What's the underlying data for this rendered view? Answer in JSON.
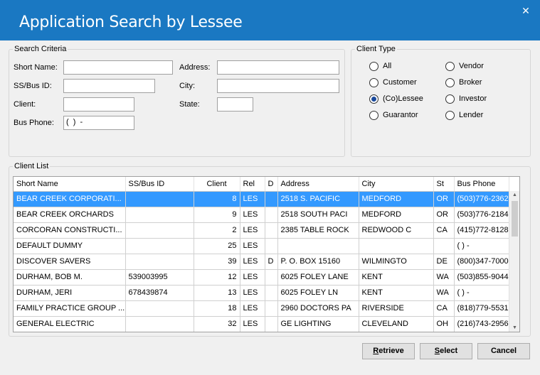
{
  "window": {
    "title": "Application Search by Lessee",
    "close_glyph": "✕"
  },
  "search_criteria": {
    "legend": "Search Criteria",
    "short_name_label": "Short Name:",
    "short_name_value": "",
    "ss_bus_id_label": "SS/Bus ID:",
    "ss_bus_id_value": "",
    "client_label": "Client:",
    "client_value": "",
    "bus_phone_label": "Bus Phone:",
    "bus_phone_value": "(  )  -",
    "address_label": "Address:",
    "address_value": "",
    "city_label": "City:",
    "city_value": "",
    "state_label": "State:",
    "state_value": ""
  },
  "client_type": {
    "legend": "Client Type",
    "options": [
      {
        "label": "All",
        "selected": false
      },
      {
        "label": "Customer",
        "selected": false
      },
      {
        "label": "(Co)Lessee",
        "selected": true
      },
      {
        "label": "Guarantor",
        "selected": false
      },
      {
        "label": "Vendor",
        "selected": false
      },
      {
        "label": "Broker",
        "selected": false
      },
      {
        "label": "Investor",
        "selected": false
      },
      {
        "label": "Lender",
        "selected": false
      }
    ]
  },
  "client_list": {
    "legend": "Client List",
    "columns": [
      "Short Name",
      "SS/Bus ID",
      "Client",
      "Rel",
      "D",
      "Address",
      "City",
      "St",
      "Bus Phone"
    ],
    "rows": [
      [
        "BEAR CREEK CORPORATI...",
        "",
        "8",
        "LES",
        "",
        "2518 S. PACIFIC",
        "MEDFORD",
        "OR",
        "(503)776-2362"
      ],
      [
        "BEAR CREEK ORCHARDS",
        "",
        "9",
        "LES",
        "",
        "2518 SOUTH PACI",
        "MEDFORD",
        "OR",
        "(503)776-2184"
      ],
      [
        "CORCORAN CONSTRUCTI...",
        "",
        "2",
        "LES",
        "",
        "2385 TABLE ROCK",
        "REDWOOD C",
        "CA",
        "(415)772-8128"
      ],
      [
        "DEFAULT DUMMY",
        "",
        "25",
        "LES",
        "",
        "",
        "",
        "",
        "(  )  -"
      ],
      [
        "DISCOVER SAVERS",
        "",
        "39",
        "LES",
        "D",
        "P. O. BOX 15160",
        "WILMINGTO",
        "DE",
        "(800)347-7000"
      ],
      [
        "DURHAM, BOB M.",
        "539003995",
        "12",
        "LES",
        "",
        "6025 FOLEY LANE",
        "KENT",
        "WA",
        "(503)855-9044"
      ],
      [
        "DURHAM, JERI",
        "678439874",
        "13",
        "LES",
        "",
        "6025 FOLEY LN",
        "KENT",
        "WA",
        "(  )  -"
      ],
      [
        "FAMILY PRACTICE GROUP ...",
        "",
        "18",
        "LES",
        "",
        "2960 DOCTORS PA",
        "RIVERSIDE",
        "CA",
        "(818)779-5531"
      ],
      [
        "GENERAL ELECTRIC",
        "",
        "32",
        "LES",
        "",
        "GE LIGHTING",
        "CLEVELAND",
        "OH",
        "(216)743-2956"
      ]
    ],
    "selected_row": 0
  },
  "buttons": {
    "retrieve_first": "R",
    "retrieve_rest": "etrieve",
    "select_first": "S",
    "select_rest": "elect",
    "cancel_label": "Cancel"
  },
  "colors": {
    "titlebar": "#1a78c2",
    "selection": "#3399ff"
  }
}
